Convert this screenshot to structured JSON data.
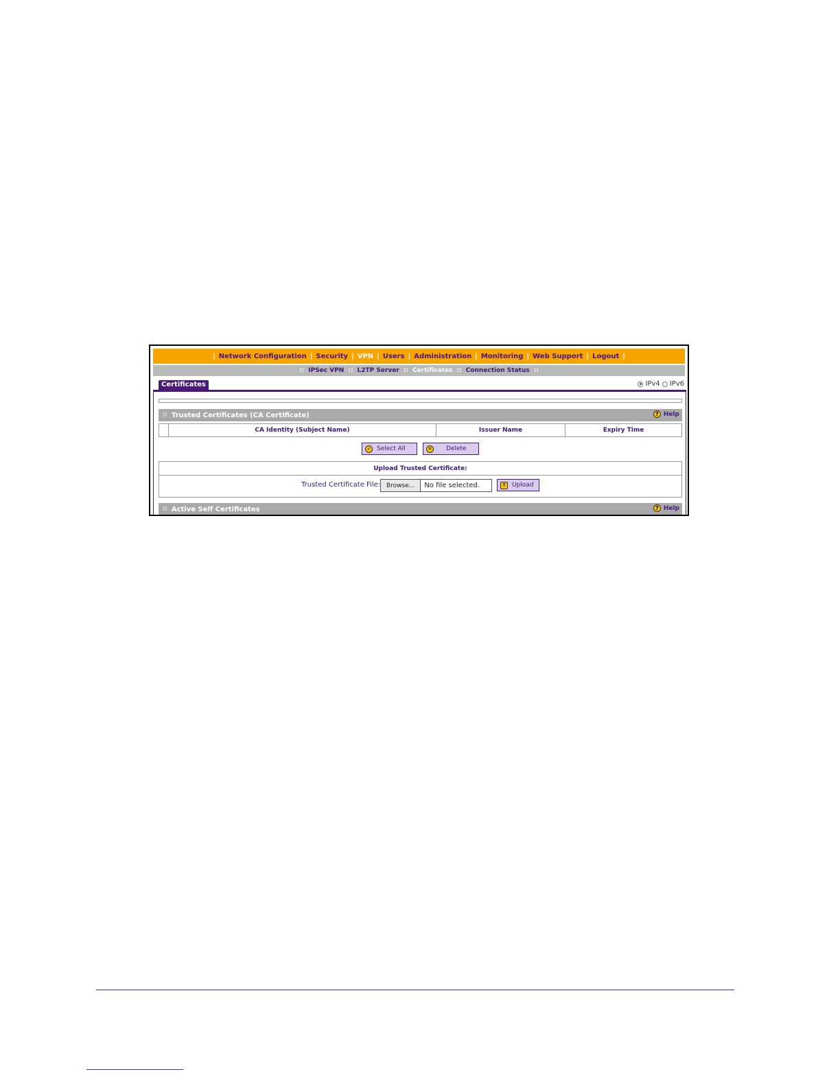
{
  "nav": {
    "items": [
      {
        "label": "Network Configuration",
        "active": false
      },
      {
        "label": "Security",
        "active": false
      },
      {
        "label": "VPN",
        "active": true
      },
      {
        "label": "Users",
        "active": false
      },
      {
        "label": "Administration",
        "active": false
      },
      {
        "label": "Monitoring",
        "active": false
      },
      {
        "label": "Web Support",
        "active": false
      },
      {
        "label": "Logout",
        "active": false
      }
    ]
  },
  "subnav": {
    "items": [
      {
        "label": "IPSec VPN",
        "active": false
      },
      {
        "label": "L2TP Server",
        "active": false
      },
      {
        "label": "Certificates",
        "active": true
      },
      {
        "label": "Connection Status",
        "active": false
      }
    ]
  },
  "page": {
    "tab_label": "Certificates",
    "ipv4_label": "IPv4",
    "ipv6_label": "IPv6",
    "ip_selected": "IPv4"
  },
  "trusted": {
    "title": "Trusted Certificates (CA Certificate)",
    "help_label": "Help",
    "columns": [
      "CA Identity (Subject Name)",
      "Issuer Name",
      "Expiry Time"
    ],
    "select_all_label": "Select All",
    "delete_label": "Delete",
    "upload_title": "Upload Trusted Certificate:",
    "file_label": "Trusted Certificate File:",
    "browse_label": "Browse...",
    "file_status": "No file selected.",
    "upload_label": "Upload"
  },
  "active_self": {
    "title": "Active Self Certificates",
    "help_label": "Help"
  },
  "colors": {
    "nav_bg": "#f7a400",
    "brand_purple": "#4a1a7a",
    "section_gray": "#a9a9a9"
  }
}
